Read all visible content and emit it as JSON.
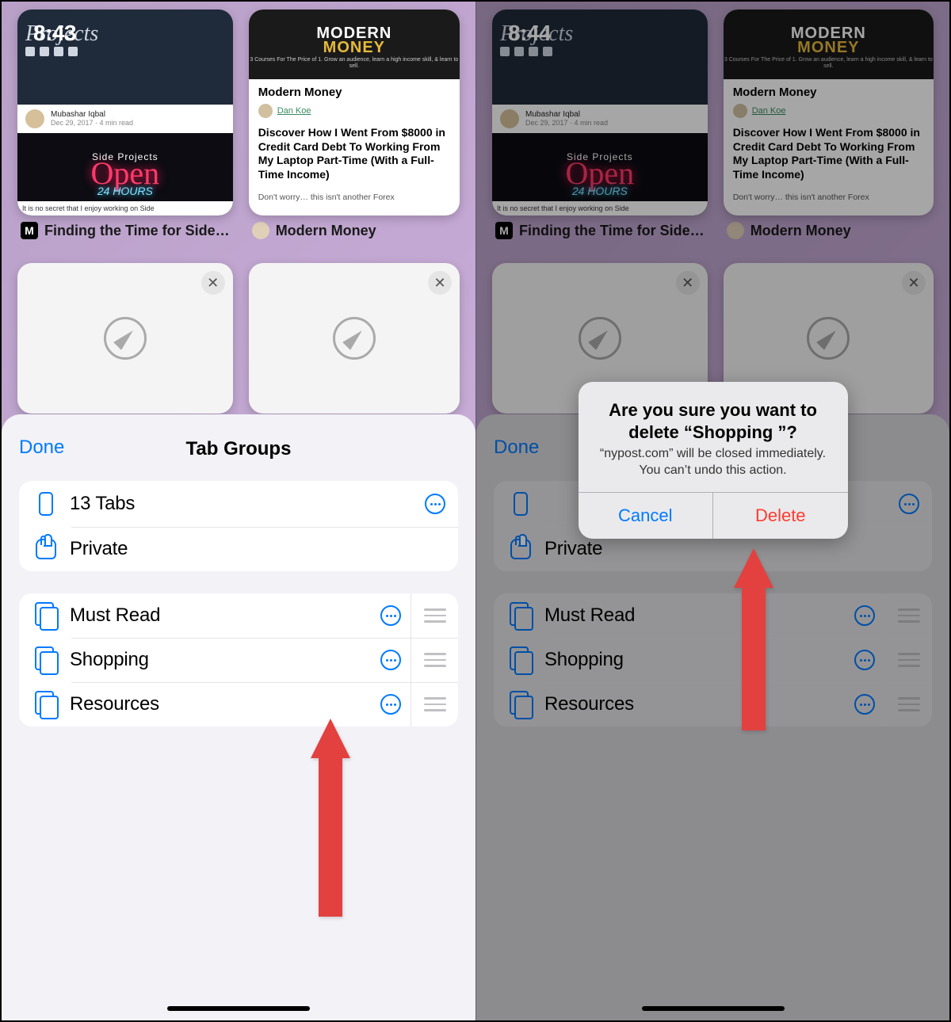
{
  "left": {
    "time": "8:43"
  },
  "right": {
    "time": "8:44"
  },
  "tabs": {
    "card1": {
      "projects_word": "Projects",
      "author": "Mubashar Iqbal",
      "meta": "Dec 29, 2017 · 4 min read",
      "side": "Side Projects",
      "open": "Open",
      "hours": "24 HOURS",
      "foot": "It is no secret that I enjoy working on Side",
      "label": "Finding the Time for Side…"
    },
    "card2": {
      "modern": "MODERN",
      "money": "MONEY",
      "sub": "3 Courses For The Price of 1.\nGrow an audience, learn a high\nincome skill, & learn to sell.",
      "title": "Modern Money",
      "author": "Dan Koe",
      "headline": "Discover How I Went From $8000 in Credit Card Debt To Working From My Laptop Part-Time (With a Full-Time Income)",
      "footer": "Don't worry… this isn't another Forex",
      "label": "Modern Money"
    }
  },
  "sheet": {
    "done": "Done",
    "title": "Tab Groups",
    "rows1": [
      {
        "label": "13 Tabs",
        "has_more": true
      },
      {
        "label": "Private",
        "has_more": false
      }
    ],
    "rows2": [
      {
        "label": "Must Read"
      },
      {
        "label": "Shopping"
      },
      {
        "label": "Resources"
      }
    ]
  },
  "alert": {
    "title": "Are you sure you want to delete “Shopping ”?",
    "message": "“nypost.com” will be closed immediately. You can’t undo this action.",
    "cancel": "Cancel",
    "delete": "Delete"
  }
}
